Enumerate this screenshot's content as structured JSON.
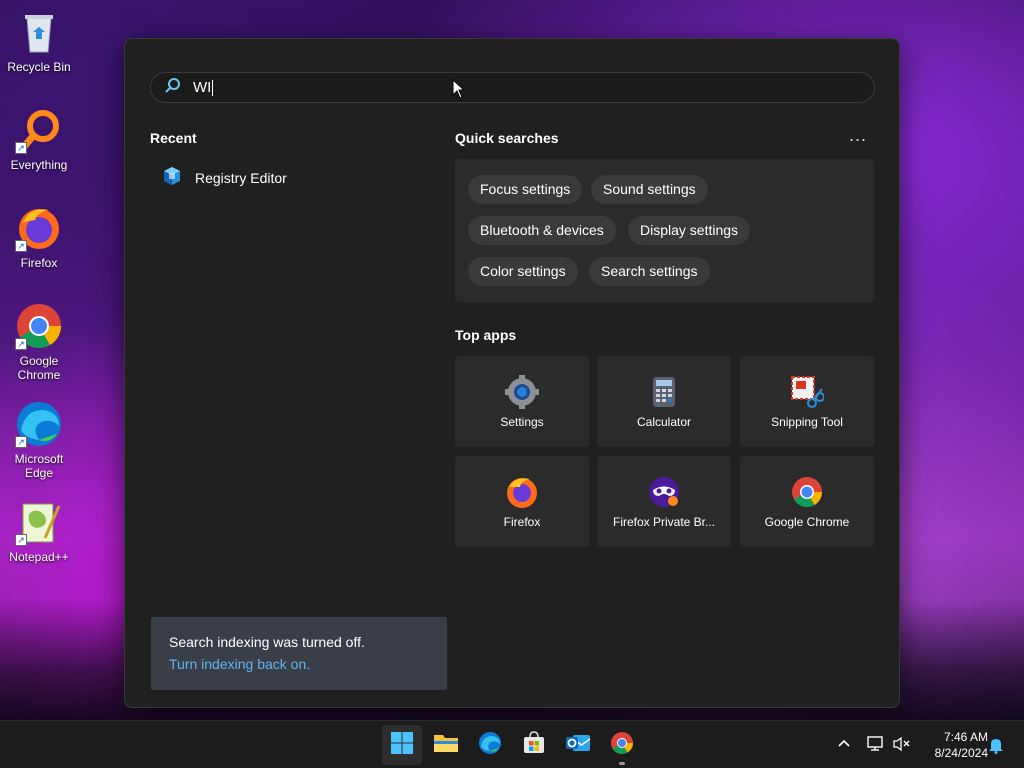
{
  "desktop": {
    "icons": [
      {
        "label": "Recycle Bin"
      },
      {
        "label": "Everything"
      },
      {
        "label": "Firefox"
      },
      {
        "label": "Google Chrome"
      },
      {
        "label": "Microsoft Edge"
      },
      {
        "label": "Notepad++"
      }
    ]
  },
  "search": {
    "query": "WI"
  },
  "recent": {
    "title": "Recent",
    "items": [
      {
        "label": "Registry Editor",
        "icon": "registry-editor-icon"
      }
    ]
  },
  "quick_searches": {
    "title": "Quick searches",
    "more": "...",
    "chips": [
      {
        "label": "Focus settings"
      },
      {
        "label": "Sound settings"
      },
      {
        "label": "Bluetooth & devices"
      },
      {
        "label": "Display settings"
      },
      {
        "label": "Color settings"
      },
      {
        "label": "Search settings"
      }
    ]
  },
  "top_apps": {
    "title": "Top apps",
    "apps": [
      {
        "label": "Settings",
        "icon": "settings-gear-icon"
      },
      {
        "label": "Calculator",
        "icon": "calculator-icon"
      },
      {
        "label": "Snipping Tool",
        "icon": "snipping-tool-icon"
      },
      {
        "label": "Firefox",
        "icon": "firefox-icon"
      },
      {
        "label": "Firefox Private Br...",
        "icon": "firefox-private-icon"
      },
      {
        "label": "Google Chrome",
        "icon": "chrome-icon"
      }
    ]
  },
  "notice": {
    "message": "Search indexing was turned off.",
    "link": "Turn indexing back on."
  },
  "taskbar": {
    "apps": [
      "start-icon",
      "file-explorer-icon",
      "edge-icon",
      "store-icon",
      "outlook-icon",
      "chrome-icon"
    ],
    "time": "7:46 AM",
    "date": "8/24/2024"
  },
  "colors": {
    "accent_link": "#5cb6f4",
    "panel_bg": "#202020",
    "tile_bg": "#2b2b2b",
    "chip_bg": "#3a3a3a"
  }
}
